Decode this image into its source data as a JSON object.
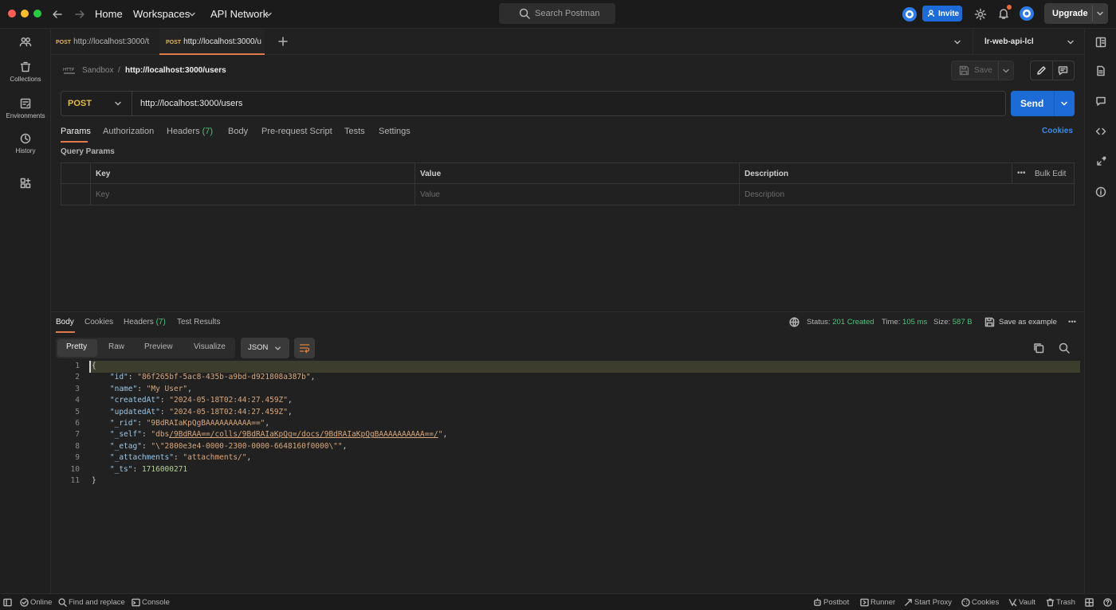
{
  "topbar": {
    "nav": {
      "home": "Home",
      "workspaces": "Workspaces",
      "api_network": "API Network"
    },
    "search_placeholder": "Search Postman",
    "invite": "Invite",
    "upgrade": "Upgrade"
  },
  "leftnav": [
    {
      "label": "",
      "icon": "team-icon"
    },
    {
      "label": "Collections",
      "icon": "trash-can-icon"
    },
    {
      "label": "Environments",
      "icon": "environment-icon"
    },
    {
      "label": "History",
      "icon": "history-icon"
    },
    {
      "label": "",
      "icon": "add-block-icon"
    }
  ],
  "tabs": [
    {
      "method": "POST",
      "url": "http://localhost:3000/t"
    },
    {
      "method": "POST",
      "url": "http://localhost:3000/u"
    }
  ],
  "environment": "lr-web-api-lcl",
  "breadcrumb": {
    "parent": "Sandbox",
    "sep": "/",
    "current": "http://localhost:3000/users"
  },
  "save_label": "Save",
  "request": {
    "method": "POST",
    "url": "http://localhost:3000/users",
    "send_label": "Send"
  },
  "request_tabs": {
    "params": "Params",
    "authorization": "Authorization",
    "headers": "Headers",
    "headers_count": "(7)",
    "body": "Body",
    "prerequest": "Pre-request Script",
    "tests": "Tests",
    "settings": "Settings",
    "cookies": "Cookies"
  },
  "query_params": {
    "title": "Query Params",
    "headers": {
      "key": "Key",
      "value": "Value",
      "description": "Description",
      "bulk_edit": "Bulk Edit",
      "more": "•••"
    },
    "placeholders": {
      "key": "Key",
      "value": "Value",
      "description": "Description"
    }
  },
  "response_tabs": {
    "body": "Body",
    "cookies": "Cookies",
    "headers": "Headers",
    "headers_count": "(7)",
    "test_results": "Test Results"
  },
  "status": {
    "status_label": "Status:",
    "status_value": "201 Created",
    "time_label": "Time:",
    "time_value": "105 ms",
    "size_label": "Size:",
    "size_value": "587 B",
    "save_example": "Save as example",
    "more": "•••"
  },
  "view_tabs": {
    "pretty": "Pretty",
    "raw": "Raw",
    "preview": "Preview",
    "visualize": "Visualize"
  },
  "format": "JSON",
  "code": {
    "line_numbers": [
      "1",
      "2",
      "3",
      "4",
      "5",
      "6",
      "7",
      "8",
      "9",
      "10",
      "11"
    ],
    "open": "{",
    "close": "}",
    "lines": [
      {
        "key": "\"id\"",
        "value": "\"86f265bf-5ac8-435b-a9bd-d921808a387b\"",
        "comma": ","
      },
      {
        "key": "\"name\"",
        "value": "\"My User\"",
        "comma": ","
      },
      {
        "key": "\"createdAt\"",
        "value": "\"2024-05-18T02:44:27.459Z\"",
        "comma": ","
      },
      {
        "key": "\"updatedAt\"",
        "value": "\"2024-05-18T02:44:27.459Z\"",
        "comma": ","
      },
      {
        "key": "\"_rid\"",
        "value": "\"9BdRAIaKpQgBAAAAAAAAAA==\"",
        "comma": ","
      },
      {
        "key": "\"_self\"",
        "value_prefix": "\"dbs",
        "value_link": "/9BdRAA==/colls/9BdRAIaKpQg=/docs/9BdRAIaKpQgBAAAAAAAAAA==/",
        "value_suffix": "\"",
        "comma": ","
      },
      {
        "key": "\"_etag\"",
        "value": "\"\\\"2800e3e4-0000-2300-0000-6648160f0000\\\"\"",
        "comma": ","
      },
      {
        "key": "\"_attachments\"",
        "value": "\"attachments/\"",
        "comma": ","
      },
      {
        "key": "\"_ts\"",
        "value": "1716000271",
        "comma": ""
      }
    ]
  },
  "statusbar": {
    "online": "Online",
    "find_replace": "Find and replace",
    "console": "Console",
    "postbot": "Postbot",
    "runner": "Runner",
    "start_proxy": "Start Proxy",
    "cookies": "Cookies",
    "vault": "Vault",
    "trash": "Trash"
  },
  "colors": {
    "accent": "#1d6bd6",
    "method": "#e5b94a",
    "success": "#4ec27a",
    "tab_underline": "#e07a4a"
  }
}
